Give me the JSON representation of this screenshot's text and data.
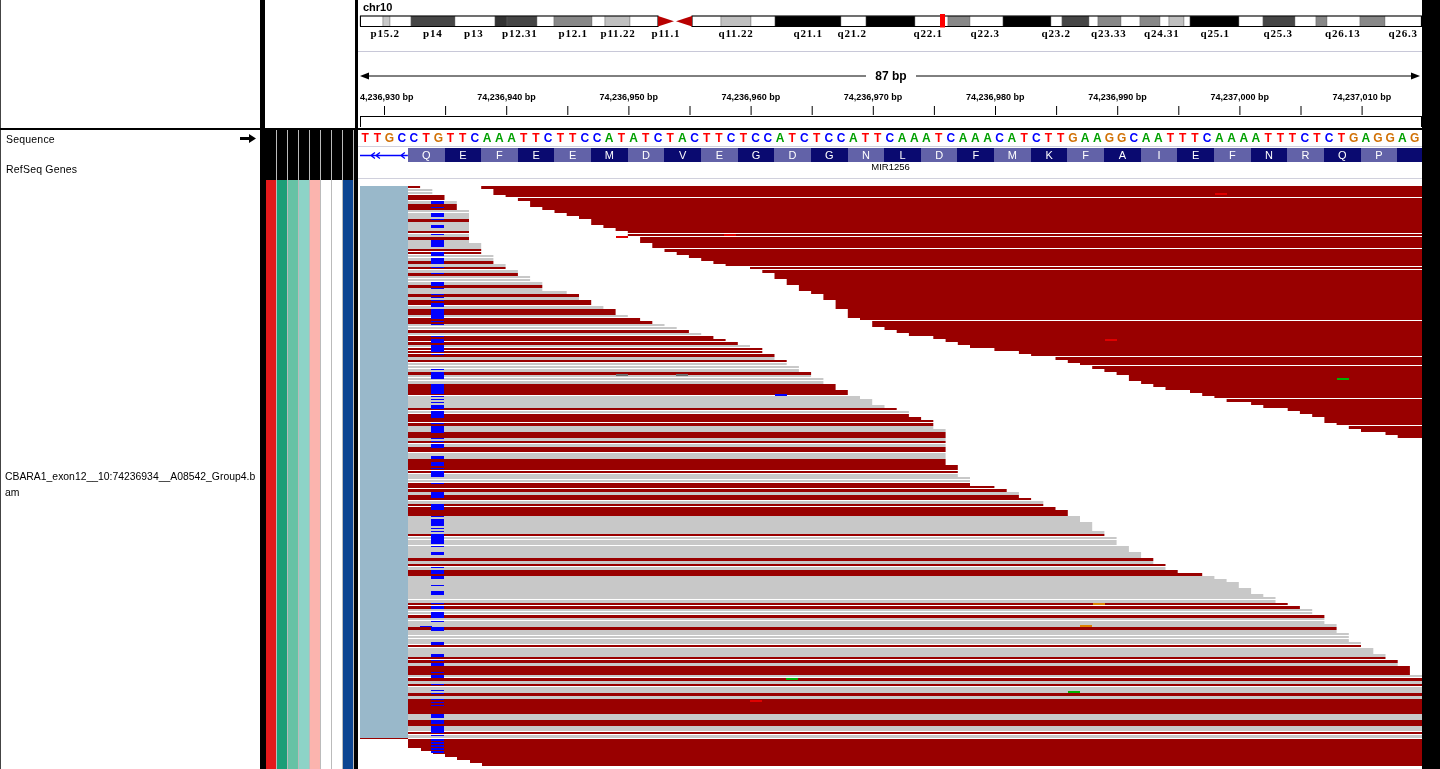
{
  "header": {
    "chromosome": "chr10",
    "band_labels": [
      "p15.2",
      "p14",
      "p13",
      "p12.31",
      "p12.1",
      "p11.22",
      "p11.1",
      "q11.22",
      "q21.1",
      "q21.2",
      "q22.1",
      "q22.3",
      "q23.2",
      "q23.33",
      "q24.31",
      "q25.1",
      "q25.3",
      "q26.13",
      "q26.3"
    ]
  },
  "ruler": {
    "span": "87 bp",
    "tick_labels": [
      "4,236,930 bp",
      "74,236,940 bp",
      "74,236,950 bp",
      "74,236,960 bp",
      "74,236,970 bp",
      "74,236,980 bp",
      "74,236,990 bp",
      "74,237,000 bp",
      "74,237,010 bp"
    ]
  },
  "tracks": [
    {
      "kind": "sequence",
      "name": "Sequence",
      "bases": [
        "T",
        "T",
        "G",
        "C",
        "C",
        "T",
        "G",
        "T",
        "T",
        "C",
        "A",
        "A",
        "A",
        "T",
        "T",
        "C",
        "T",
        "T",
        "C",
        "C",
        "A",
        "T",
        "A",
        "T",
        "C",
        "T",
        "A",
        "C",
        "T",
        "T",
        "C",
        "T",
        "C",
        "C",
        "A",
        "T",
        "C",
        "T",
        "C",
        "C",
        "A",
        "T",
        "T",
        "C",
        "A",
        "A",
        "A",
        "T",
        "C",
        "A",
        "A",
        "A",
        "C",
        "A",
        "T",
        "C",
        "T",
        "T",
        "G",
        "A",
        "A",
        "G",
        "G",
        "C",
        "A",
        "A",
        "T",
        "T",
        "T",
        "C",
        "A",
        "A",
        "A",
        "A",
        "T",
        "T",
        "T",
        "C",
        "T",
        "C",
        "T",
        "G",
        "A",
        "G",
        "G",
        "A",
        "G"
      ]
    },
    {
      "kind": "gene",
      "name": "RefSeq Genes",
      "gene_name": "MIR1256",
      "amino_acids": [
        "Q",
        "E",
        "F",
        "E",
        "E",
        "M",
        "D",
        "V",
        "E",
        "G",
        "D",
        "G",
        "N",
        "L",
        "D",
        "F",
        "M",
        "K",
        "F",
        "A",
        "I",
        "E",
        "F",
        "N",
        "R",
        "Q",
        "P"
      ]
    },
    {
      "kind": "alignment",
      "name": "CBARA1_exon12__10:74236934__A08542_Group4.bam",
      "attributes": [
        {
          "color": "#e41a1c"
        },
        {
          "color": "#1b9e77"
        },
        {
          "color": "#66c2a5"
        },
        {
          "color": "#8dd3c7"
        },
        {
          "color": "#fbb4ae"
        },
        {
          "color": "#ffffff"
        },
        {
          "color": "#ffffff"
        },
        {
          "color": "#0c4592"
        }
      ]
    }
  ]
}
